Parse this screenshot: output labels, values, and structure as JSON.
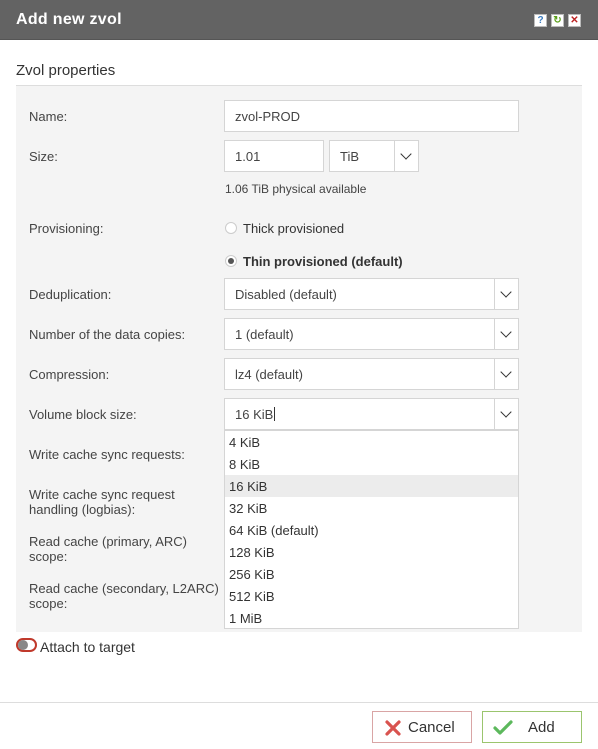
{
  "dialog": {
    "title": "Add new zvol",
    "help_icon": "?",
    "refresh_icon": "↻",
    "close_icon": "✕"
  },
  "section": {
    "title": "Zvol properties"
  },
  "form": {
    "name_label": "Name:",
    "name_value": "zvol-PROD",
    "size_label": "Size:",
    "size_value": "1.01",
    "size_unit": "TiB",
    "size_hint": "1.06 TiB physical available",
    "provisioning_label": "Provisioning:",
    "provisioning_options": [
      "Thick provisioned",
      "Thin provisioned (default)"
    ],
    "provisioning_selected": "Thin provisioned (default)",
    "dedup_label": "Deduplication:",
    "dedup_value": "Disabled (default)",
    "copies_label": "Number of the data copies:",
    "copies_value": "1 (default)",
    "compression_label": "Compression:",
    "compression_value": "lz4 (default)",
    "blocksize_label": "Volume block size:",
    "blocksize_value": "16 KiB",
    "write_cache_label": "Write cache sync requests:",
    "logbias_label_1": "Write cache sync request",
    "logbias_label_2": "handling (logbias):",
    "read_primary_label_1": "Read cache (primary, ARC)",
    "read_primary_label_2": "scope:",
    "read_secondary_label_1": "Read cache (secondary, L2ARC)",
    "read_secondary_label_2": "scope:"
  },
  "blocksize_options": [
    "4 KiB",
    "8 KiB",
    "16 KiB",
    "32 KiB",
    "64 KiB (default)",
    "128 KiB",
    "256 KiB",
    "512 KiB",
    "1 MiB"
  ],
  "blocksize_highlighted": "16 KiB",
  "attach": {
    "label": "Attach to target",
    "enabled": false
  },
  "footer": {
    "cancel_label": "Cancel",
    "add_label": "Add"
  },
  "colors": {
    "titlebar": "#636363",
    "cancel_icon": "#d9534f",
    "add_icon": "#5cb85c"
  }
}
